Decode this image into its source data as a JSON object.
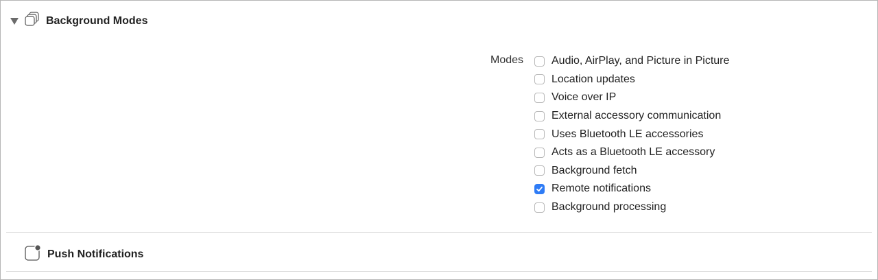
{
  "background_modes": {
    "title": "Background Modes",
    "modes_label": "Modes",
    "modes": [
      {
        "label": "Audio, AirPlay, and Picture in Picture",
        "checked": false
      },
      {
        "label": "Location updates",
        "checked": false
      },
      {
        "label": "Voice over IP",
        "checked": false
      },
      {
        "label": "External accessory communication",
        "checked": false
      },
      {
        "label": "Uses Bluetooth LE accessories",
        "checked": false
      },
      {
        "label": "Acts as a Bluetooth LE accessory",
        "checked": false
      },
      {
        "label": "Background fetch",
        "checked": false
      },
      {
        "label": "Remote notifications",
        "checked": true
      },
      {
        "label": "Background processing",
        "checked": false
      }
    ]
  },
  "push_notifications": {
    "title": "Push Notifications"
  },
  "colors": {
    "accent": "#2f7cf6"
  }
}
